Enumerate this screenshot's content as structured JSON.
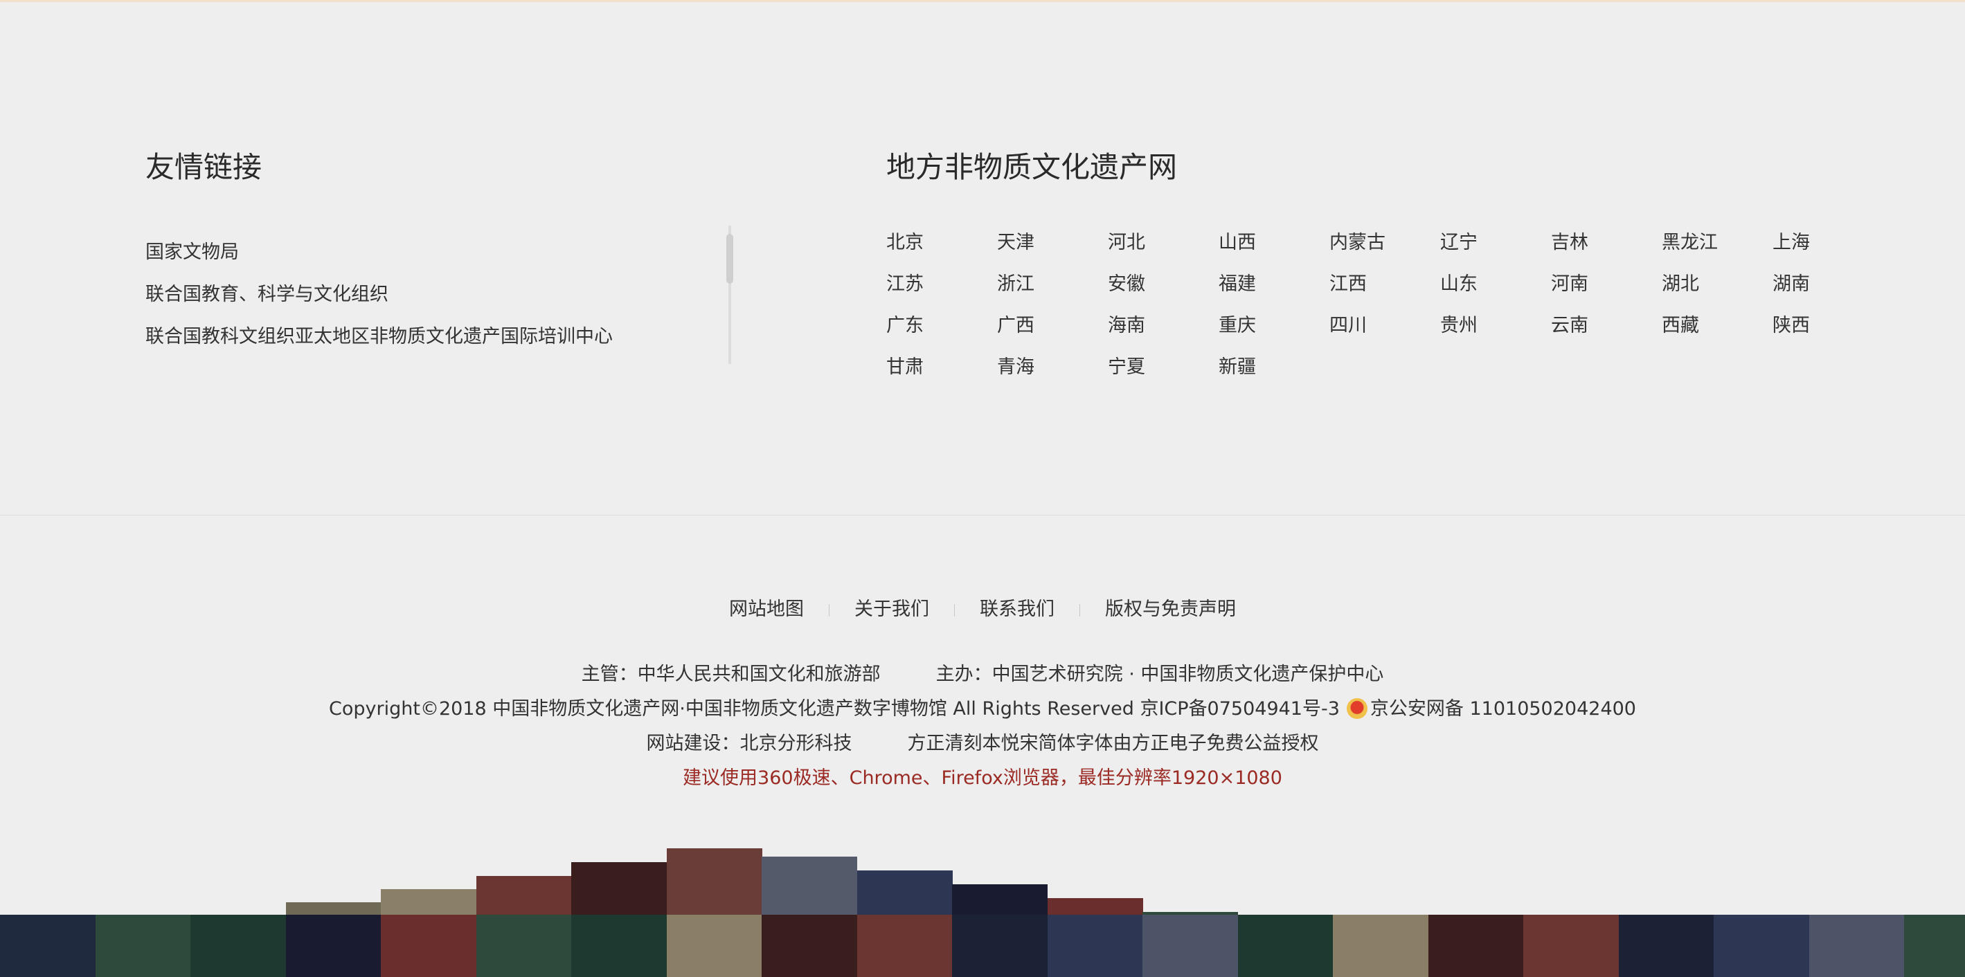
{
  "friend_links": {
    "title": "友情链接",
    "items": [
      "国家文物局",
      "联合国教育、科学与文化组织",
      "联合国教科文组织亚太地区非物质文化遗产国际培训中心"
    ]
  },
  "regional_sites": {
    "title": "地方非物质文化遗产网",
    "provinces": [
      "北京",
      "天津",
      "河北",
      "山西",
      "内蒙古",
      "辽宁",
      "吉林",
      "黑龙江",
      "上海",
      "江苏",
      "浙江",
      "安徽",
      "福建",
      "江西",
      "山东",
      "河南",
      "湖北",
      "湖南",
      "广东",
      "广西",
      "海南",
      "重庆",
      "四川",
      "贵州",
      "云南",
      "西藏",
      "陕西",
      "甘肃",
      "青海",
      "宁夏",
      "新疆"
    ]
  },
  "footer": {
    "nav": [
      "网站地图",
      "关于我们",
      "联系我们",
      "版权与免责声明"
    ],
    "supervisor": "主管：中华人民共和国文化和旅游部",
    "sponsor": "主办：中国艺术研究院 · 中国非物质文化遗产保护中心",
    "copyright": "Copyright©2018 中国非物质文化遗产网·中国非物质文化遗产数字博物馆 All Rights Reserved 京ICP备07504941号-3",
    "police_record": "京公安网备 11010502042400",
    "builder": "网站建设：北京分形科技",
    "font_license": "方正清刻本悦宋简体字体由方正电子免费公益授权",
    "browser_notice": "建议使用360极速、Chrome、Firefox浏览器，最佳分辨率1920×1080"
  },
  "decor": {
    "bar_colors": [
      "#1f2a3f",
      "#2e4a3d",
      "#1e3a30",
      "#6e6a55",
      "#8a8068",
      "#6b3532",
      "#3a1e1e",
      "#6a3d38",
      "#555a6a",
      "#2d3754",
      "#191c30",
      "#6a2e2d",
      "#2e4a3d",
      "#1e3a30",
      "#8a7e66",
      "#3a1e1e",
      "#6b3532",
      "#1c2236",
      "#2d3754",
      "#4e5468",
      "#2e4a3d"
    ]
  }
}
